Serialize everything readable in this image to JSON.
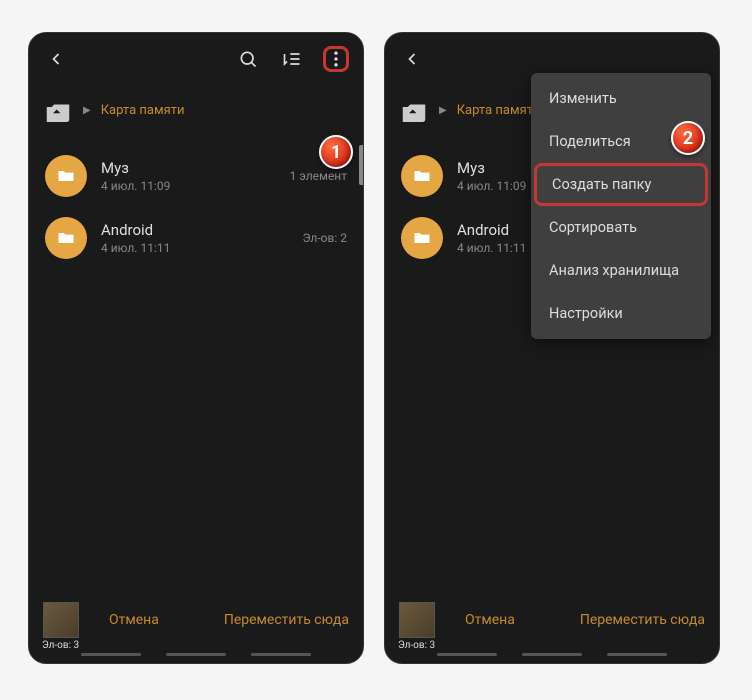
{
  "breadcrumb": {
    "location": "Карта памяти"
  },
  "files": [
    {
      "name": "Муз",
      "date": "4 июл. 11:09",
      "meta": "1 элемент"
    },
    {
      "name": "Android",
      "date": "4 июл. 11:11",
      "meta": "Эл-ов: 2"
    }
  ],
  "selection": {
    "count_label": "Эл-ов: 3"
  },
  "actions": {
    "cancel": "Отмена",
    "move_here": "Переместить сюда"
  },
  "menu": {
    "edit": "Изменить",
    "share": "Поделиться",
    "create_folder": "Создать папку",
    "sort": "Сортировать",
    "storage_analysis": "Анализ хранилища",
    "settings": "Настройки"
  },
  "callouts": {
    "one": "1",
    "two": "2"
  }
}
